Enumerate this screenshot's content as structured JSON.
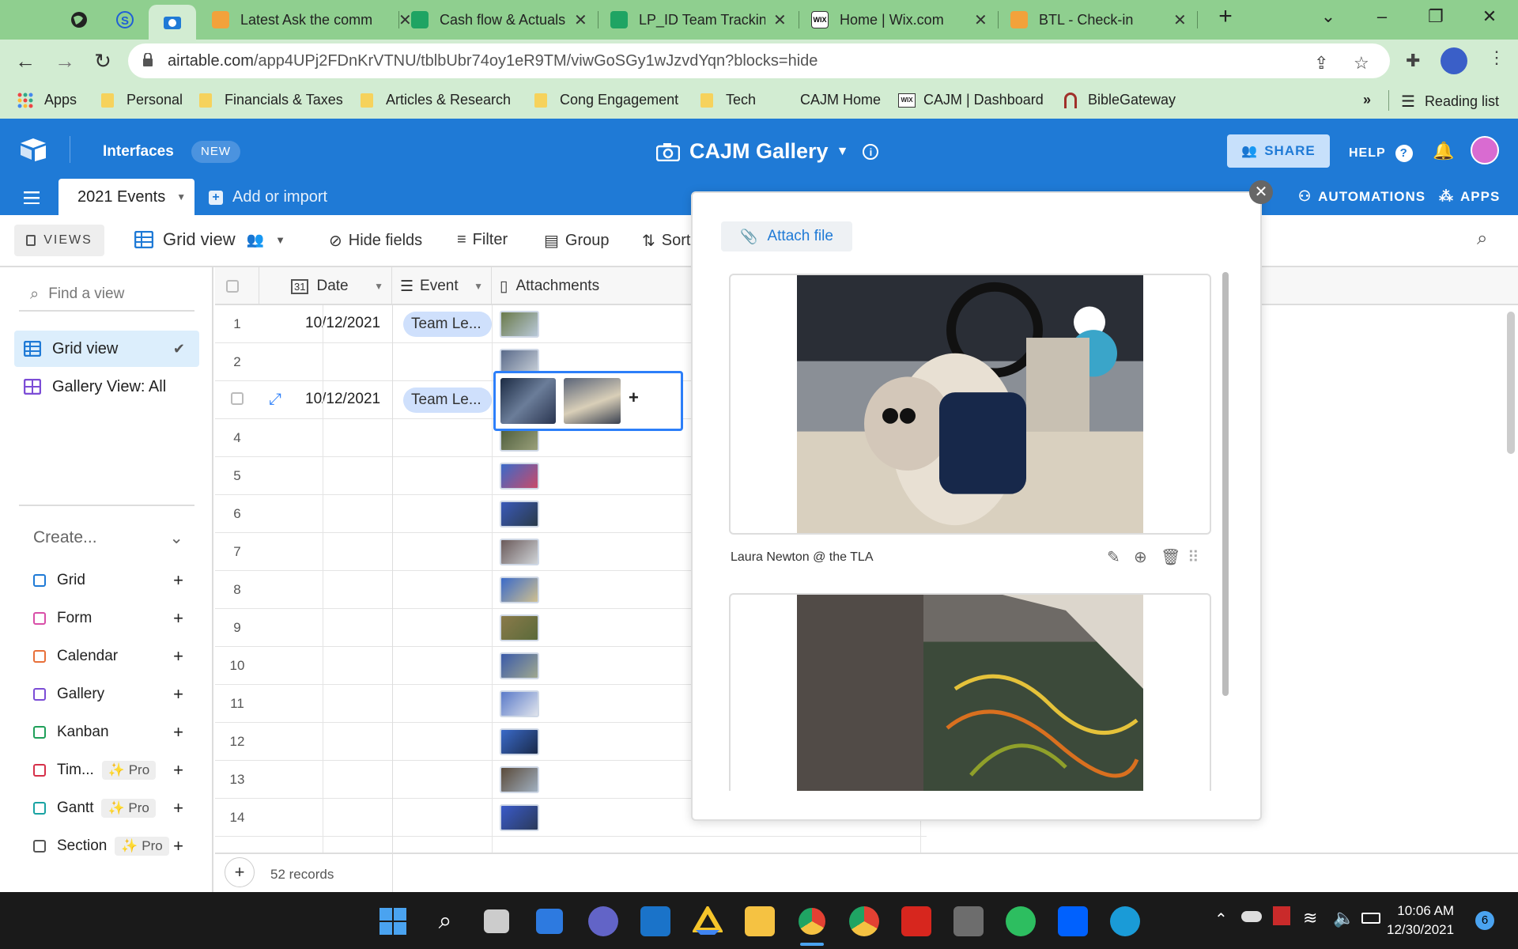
{
  "browser": {
    "tabs": [
      {
        "label": "Latest Ask the comm",
        "fav": "#f2a23b"
      },
      {
        "label": "Cash flow & Actuals",
        "fav": "#1fa463"
      },
      {
        "label": "LP_ID Team Tracking",
        "fav": "#1fa463"
      },
      {
        "label": "Home | Wix.com",
        "fav": "#ffffff"
      },
      {
        "label": "BTL - Check-in",
        "fav": "#f2a23b"
      }
    ],
    "url_host": "airtable.com",
    "url_path": "/app4UPj2FDnKrVTNU/tblbUbr74oy1eR9TM/viwGoSGy1wJzvdYqn?blocks=hide",
    "bookmarks": [
      "Apps",
      "Personal",
      "Financials & Taxes",
      "Articles & Research",
      "Cong Engagement",
      "Tech",
      "CAJM Home",
      "CAJM | Dashboard",
      "BibleGateway"
    ],
    "reading_list": "Reading list",
    "more_bookmarks": "»"
  },
  "header": {
    "interfaces": "Interfaces",
    "new_badge": "NEW",
    "base_title": "CAJM Gallery",
    "share": "SHARE",
    "help": "HELP",
    "table_tab": "2021 Events",
    "add_import": "Add or import",
    "automations": "AUTOMATIONS",
    "apps": "APPS"
  },
  "toolbar": {
    "views": "VIEWS",
    "view_name": "Grid view",
    "hide_fields": "Hide fields",
    "filter": "Filter",
    "group": "Group",
    "sort": "Sort"
  },
  "sidebar": {
    "find_placeholder": "Find a view",
    "views": [
      {
        "label": "Grid view",
        "active": true
      },
      {
        "label": "Gallery View: All",
        "active": false
      }
    ],
    "create_label": "Create...",
    "create_items": [
      {
        "label": "Grid",
        "color": "#1f7ad6",
        "pro": false
      },
      {
        "label": "Form",
        "color": "#d94fa8",
        "pro": false
      },
      {
        "label": "Calendar",
        "color": "#e8703a",
        "pro": false
      },
      {
        "label": "Gallery",
        "color": "#7c4dd6",
        "pro": false
      },
      {
        "label": "Kanban",
        "color": "#20a05a",
        "pro": false
      },
      {
        "label": "Tim...",
        "color": "#d6314a",
        "pro": true
      },
      {
        "label": "Gantt",
        "color": "#19a3a3",
        "pro": true
      },
      {
        "label": "Section",
        "color": "#555555",
        "pro": true
      }
    ],
    "pro_label": "Pro"
  },
  "grid": {
    "columns": {
      "date": "Date",
      "event": "Event",
      "attachments": "Attachments"
    },
    "rows": [
      {
        "n": "1",
        "date": "10/12/2021",
        "event": "Team Le..."
      },
      {
        "n": "2",
        "date": "",
        "event": ""
      },
      {
        "n": "",
        "date": "10/12/2021",
        "event": "Team Le..."
      },
      {
        "n": "4",
        "date": "",
        "event": ""
      },
      {
        "n": "5",
        "date": "",
        "event": ""
      },
      {
        "n": "6",
        "date": "",
        "event": ""
      },
      {
        "n": "7",
        "date": "",
        "event": ""
      },
      {
        "n": "8",
        "date": "",
        "event": ""
      },
      {
        "n": "9",
        "date": "",
        "event": ""
      },
      {
        "n": "10",
        "date": "",
        "event": ""
      },
      {
        "n": "11",
        "date": "",
        "event": ""
      },
      {
        "n": "12",
        "date": "",
        "event": ""
      },
      {
        "n": "13",
        "date": "",
        "event": ""
      },
      {
        "n": "14",
        "date": "",
        "event": ""
      }
    ],
    "record_count": "52 records"
  },
  "popup": {
    "attach_button": "Attach file",
    "caption": "Laura Newton @ the TLA"
  },
  "taskbar": {
    "time": "10:06 AM",
    "date": "12/30/2021",
    "notifications": "6"
  },
  "colors": {
    "tabbar": "#8fcf8f",
    "airtable_blue": "#1f7ad6"
  }
}
